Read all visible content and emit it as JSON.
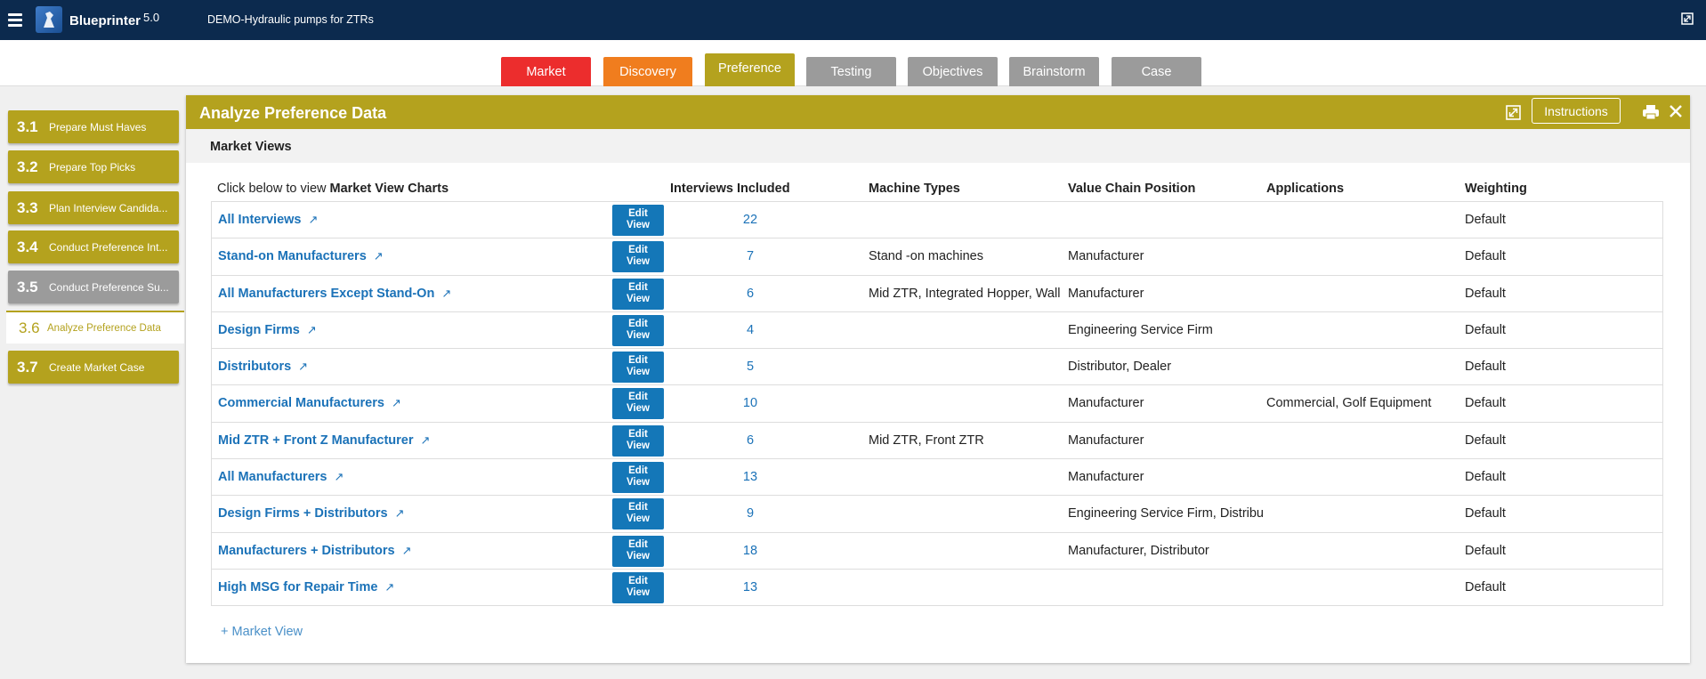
{
  "app": {
    "name": "Blueprinter",
    "version": "5.0",
    "project": "DEMO-Hydraulic pumps for ZTRs"
  },
  "colors": {
    "navy": "#0c2a4e",
    "olive": "#b4a21e",
    "gray": "#9b9b9b",
    "market": "#ec2d2d",
    "discovery": "#f07d1e",
    "link": "#1b72b8",
    "button_blue": "#1477b8"
  },
  "phases": [
    {
      "label": "Market",
      "color": "#ec2d2d"
    },
    {
      "label": "Discovery",
      "color": "#f07d1e"
    },
    {
      "label": "Preference",
      "color": "#b4a21e",
      "active": true
    },
    {
      "label": "Testing",
      "color": "#9b9b9b"
    },
    {
      "label": "Objectives",
      "color": "#9b9b9b"
    },
    {
      "label": "Brainstorm",
      "color": "#9b9b9b"
    },
    {
      "label": "Case",
      "color": "#9b9b9b"
    }
  ],
  "sidebar": {
    "items": [
      {
        "num": "3.1",
        "label": "Prepare Must Haves",
        "color": "#b4a21e"
      },
      {
        "num": "3.2",
        "label": "Prepare Top Picks",
        "color": "#b4a21e"
      },
      {
        "num": "3.3",
        "label": "Plan Interview Candida...",
        "color": "#b4a21e"
      },
      {
        "num": "3.4",
        "label": "Conduct Preference Int...",
        "color": "#b4a21e"
      },
      {
        "num": "3.5",
        "label": "Conduct Preference Su...",
        "color": "#9b9b9b"
      },
      {
        "num": "3.6",
        "label": "Analyze Preference Data",
        "color": "#b4a21e",
        "active": true
      },
      {
        "num": "3.7",
        "label": "Create Market Case",
        "color": "#b4a21e"
      }
    ]
  },
  "panel": {
    "title": "Analyze Preference Data",
    "instructions_label": "Instructions",
    "section_title": "Market Views",
    "intro_prefix": "Click below to view ",
    "intro_bold": "Market View Charts",
    "columns": {
      "interviews": "Interviews Included",
      "machine": "Machine Types",
      "vcp": "Value Chain Position",
      "app": "Applications",
      "weight": "Weighting"
    },
    "edit_label_1": "Edit",
    "edit_label_2": "View",
    "add_view_label": "+ Market View",
    "rows": [
      {
        "name": "All Interviews",
        "count": "22",
        "machine": "",
        "vcp": "",
        "app": "",
        "weight": "Default"
      },
      {
        "name": "Stand-on Manufacturers",
        "count": "7",
        "machine": "Stand -on machines",
        "vcp": "Manufacturer",
        "app": "",
        "weight": "Default"
      },
      {
        "name": "All Manufacturers Except Stand-On",
        "count": "6",
        "machine": "Mid ZTR, Integrated Hopper, Wall",
        "vcp": "Manufacturer",
        "app": "",
        "weight": "Default"
      },
      {
        "name": "Design Firms",
        "count": "4",
        "machine": "",
        "vcp": "Engineering Service Firm",
        "app": "",
        "weight": "Default"
      },
      {
        "name": "Distributors",
        "count": "5",
        "machine": "",
        "vcp": "Distributor, Dealer",
        "app": "",
        "weight": "Default"
      },
      {
        "name": "Commercial Manufacturers",
        "count": "10",
        "machine": "",
        "vcp": "Manufacturer",
        "app": "Commercial, Golf Equipment",
        "weight": "Default"
      },
      {
        "name": "Mid ZTR + Front Z Manufacturer",
        "count": "6",
        "machine": "Mid ZTR, Front ZTR",
        "vcp": "Manufacturer",
        "app": "",
        "weight": "Default"
      },
      {
        "name": "All Manufacturers",
        "count": "13",
        "machine": "",
        "vcp": "Manufacturer",
        "app": "",
        "weight": "Default"
      },
      {
        "name": "Design Firms + Distributors",
        "count": "9",
        "machine": "",
        "vcp": "Engineering Service Firm, Distribu",
        "app": "",
        "weight": "Default"
      },
      {
        "name": "Manufacturers + Distributors",
        "count": "18",
        "machine": "",
        "vcp": "Manufacturer, Distributor",
        "app": "",
        "weight": "Default"
      },
      {
        "name": "High MSG for Repair Time",
        "count": "13",
        "machine": "",
        "vcp": "",
        "app": "",
        "weight": "Default"
      }
    ]
  }
}
